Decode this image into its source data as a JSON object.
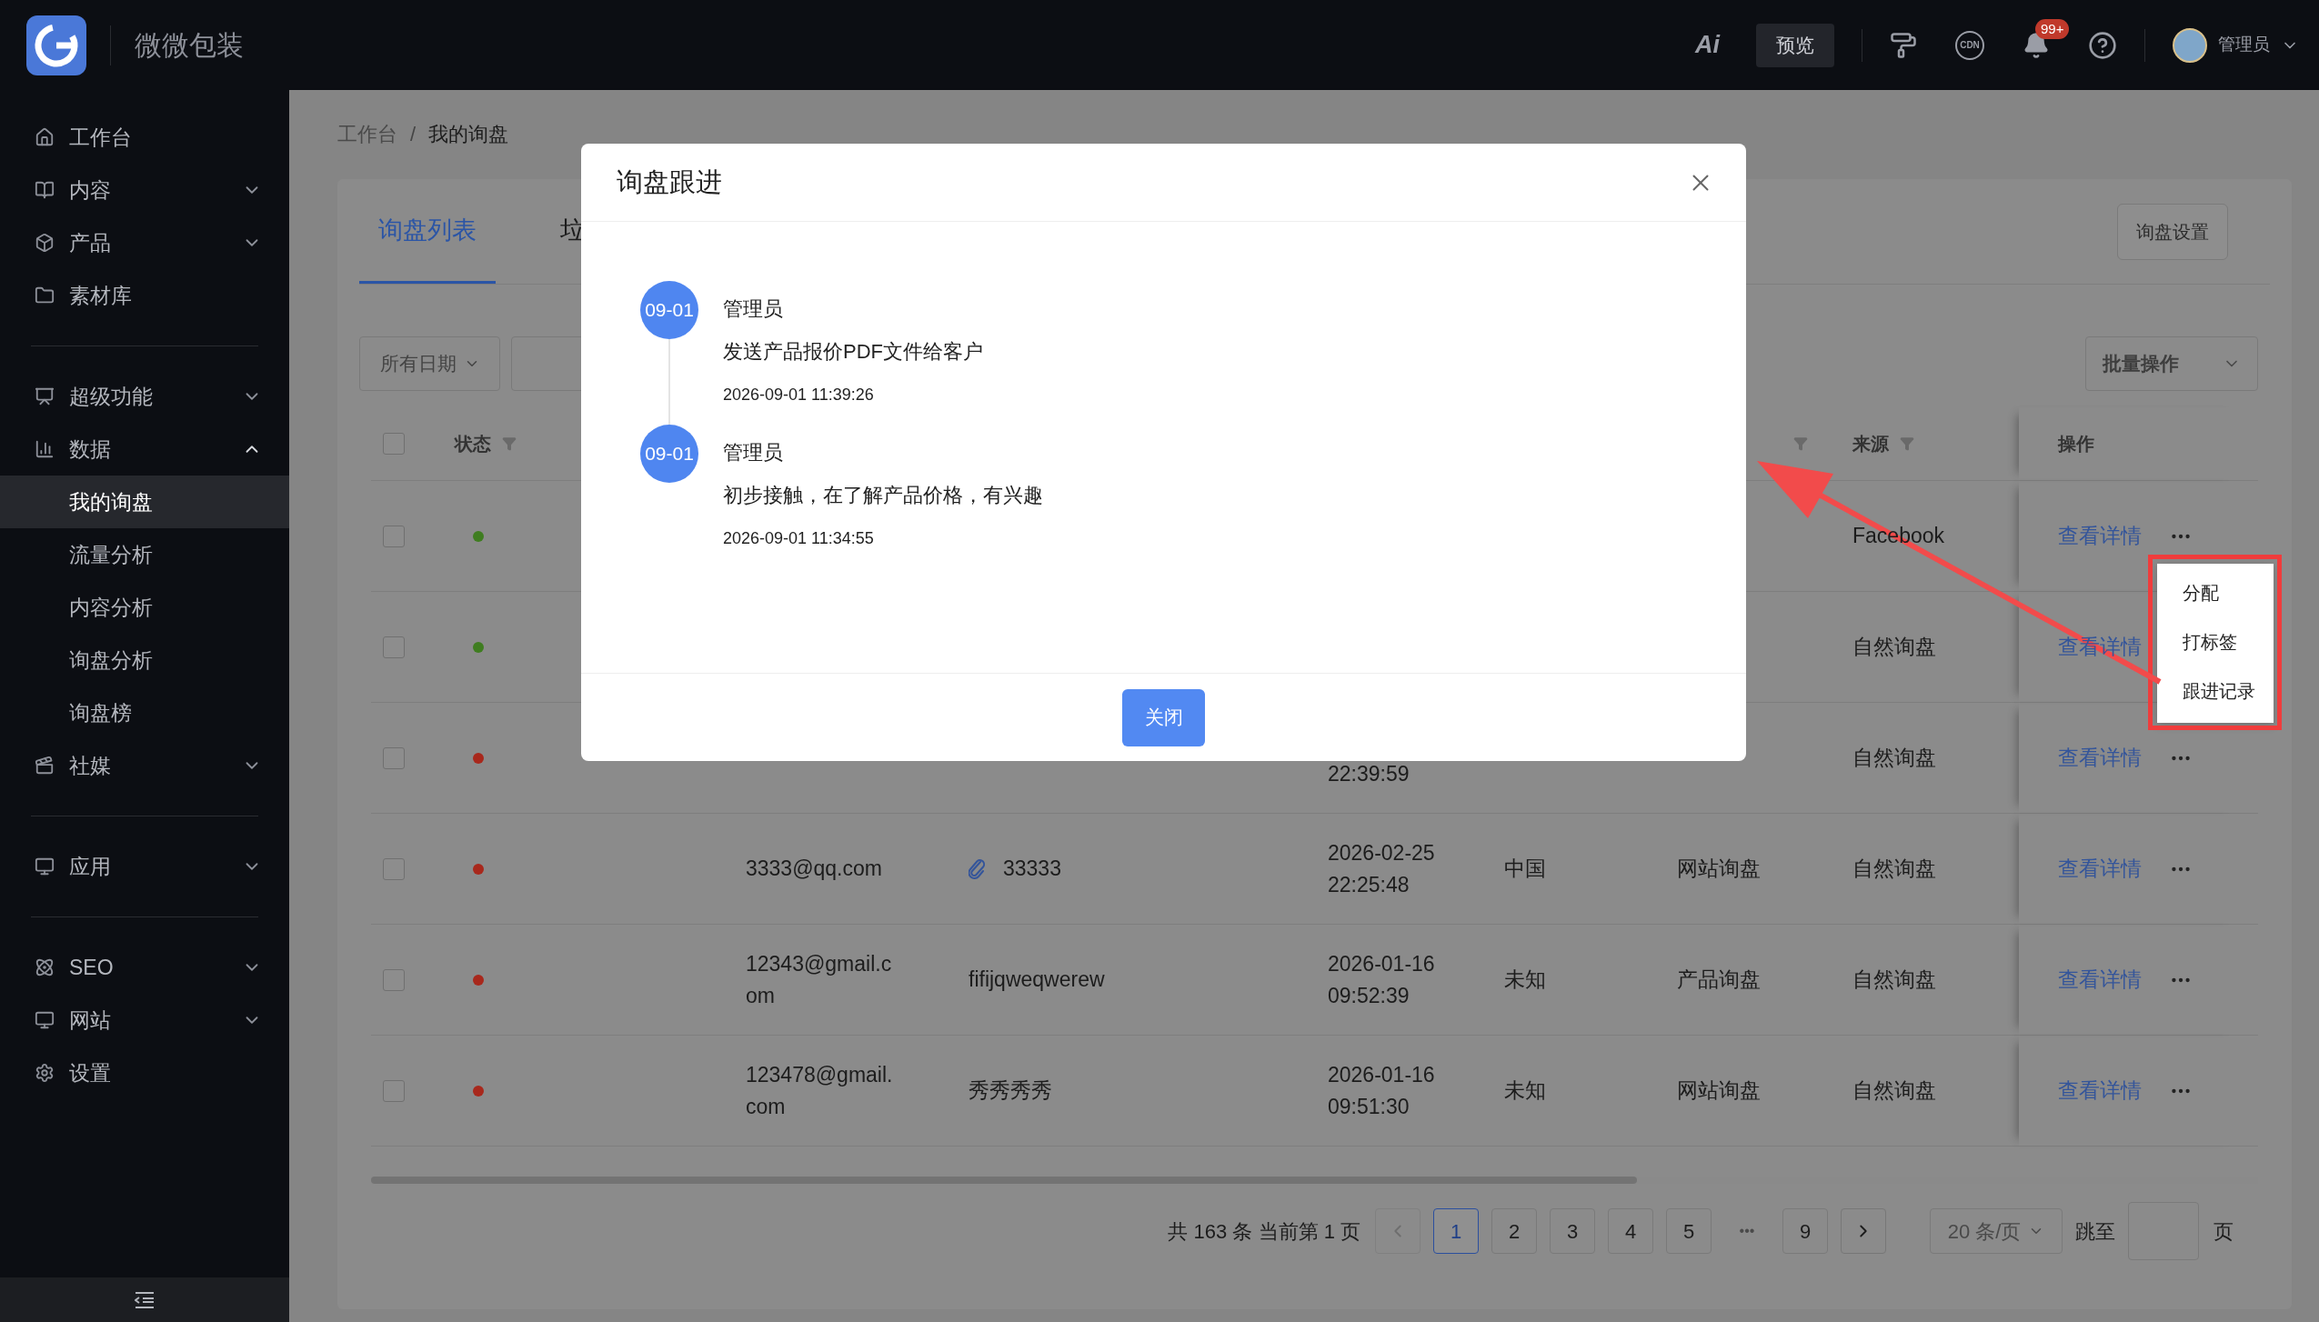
{
  "header": {
    "logo_text": "微微包装",
    "ai_label": "Ai",
    "preview_button": "预览",
    "cdn_label": "CDN",
    "notification_badge": "99+",
    "user_name": "管理员"
  },
  "sidebar": {
    "sections": [
      {
        "items": [
          {
            "label": "工作台",
            "kind": "link",
            "selected": false
          },
          {
            "label": "内容",
            "kind": "group",
            "expanded": false,
            "selected": false
          },
          {
            "label": "产品",
            "kind": "group",
            "expanded": false,
            "selected": false
          },
          {
            "label": "素材库",
            "kind": "link",
            "selected": false
          }
        ]
      },
      {
        "items": [
          {
            "label": "超级功能",
            "kind": "group",
            "expanded": false,
            "selected": false
          },
          {
            "label": "数据",
            "kind": "group",
            "expanded": true,
            "selected": false,
            "children": [
              {
                "label": "我的询盘",
                "selected": true
              },
              {
                "label": "流量分析",
                "selected": false
              },
              {
                "label": "内容分析",
                "selected": false
              },
              {
                "label": "询盘分析",
                "selected": false
              },
              {
                "label": "询盘榜",
                "selected": false
              }
            ]
          },
          {
            "label": "社媒",
            "kind": "group",
            "expanded": false,
            "selected": false
          }
        ]
      },
      {
        "items": [
          {
            "label": "应用",
            "kind": "group",
            "expanded": false,
            "selected": false
          }
        ]
      },
      {
        "items": [
          {
            "label": "SEO",
            "kind": "group",
            "expanded": false,
            "selected": false
          },
          {
            "label": "网站",
            "kind": "group",
            "expanded": false,
            "selected": false
          },
          {
            "label": "设置",
            "kind": "link",
            "selected": false
          }
        ]
      }
    ]
  },
  "breadcrumb": {
    "items": [
      "工作台",
      "我的询盘"
    ],
    "separator": "/"
  },
  "tabs": [
    {
      "label": "询盘列表",
      "selected": true
    },
    {
      "label": "垃",
      "selected": false
    }
  ],
  "settings_button": "询盘设置",
  "filters": {
    "date_select": "所有日期",
    "batch_select": "批量操作"
  },
  "table": {
    "header": {
      "select_all": {
        "checked": false
      },
      "status": {
        "label": "状态",
        "filter": true
      },
      "type": {
        "filter": true
      },
      "source": {
        "label": "来源",
        "filter": true
      },
      "actions": {
        "label": "操作"
      }
    },
    "rows": [
      {
        "checked": false,
        "color": "#3f7d20",
        "source": "Facebook",
        "action": "查看详情"
      },
      {
        "checked": false,
        "color": "#3f7d20",
        "source": "自然询盘",
        "action": "查看详情"
      },
      {
        "checked": false,
        "color": "#a8281c",
        "time_clock": "22:39:59",
        "source": "自然询盘",
        "action": "查看详情"
      },
      {
        "checked": false,
        "color": "#a8281c",
        "email": "3333@qq.com",
        "attachment": true,
        "subject": "33333",
        "time_date": "2026-02-25",
        "time_clock": "22:25:48",
        "country": "中国",
        "type": "网站询盘",
        "source": "自然询盘",
        "action": "查看详情"
      },
      {
        "checked": false,
        "color": "#a8281c",
        "email": "12343@gmail.com",
        "attachment": false,
        "subject": "fifijqweqwerew",
        "time_date": "2026-01-16",
        "time_clock": "09:52:39",
        "country": "未知",
        "type": "产品询盘",
        "source": "自然询盘",
        "action": "查看详情"
      },
      {
        "checked": false,
        "color": "#a8281c",
        "email": "123478@gmail.com",
        "attachment": false,
        "subject": "秀秀秀秀",
        "time_date": "2026-01-16",
        "time_clock": "09:51:30",
        "country": "未知",
        "type": "网站询盘",
        "source": "自然询盘",
        "action": "查看详情"
      }
    ]
  },
  "pagination": {
    "summary": "共 163 条 当前第 1 页",
    "prev": {
      "disabled": true
    },
    "next": {
      "disabled": false
    },
    "pages": [
      {
        "label": "1",
        "kind": "page",
        "selected": true
      },
      {
        "label": "2",
        "kind": "page",
        "selected": false
      },
      {
        "label": "3",
        "kind": "page",
        "selected": false
      },
      {
        "label": "4",
        "kind": "page",
        "selected": false
      },
      {
        "label": "5",
        "kind": "page",
        "selected": false
      },
      {
        "label": "•••",
        "kind": "ellipsis",
        "selected": false
      },
      {
        "label": "9",
        "kind": "page",
        "selected": false
      }
    ],
    "page_size": "20 条/页",
    "jump_label": "跳至",
    "page_suffix": "页"
  },
  "modal": {
    "title": "询盘跟进",
    "entries": [
      {
        "date_badge": "09-01",
        "author": "管理员",
        "note": "发送产品报价PDF文件给客户",
        "time": "2026-09-01 11:39:26"
      },
      {
        "date_badge": "09-01",
        "author": "管理员",
        "note": "初步接触，在了解产品价格，有兴趣",
        "time": "2026-09-01 11:34:55"
      }
    ],
    "close_button": "关闭"
  },
  "row_menu": {
    "open": true,
    "items": [
      "分配",
      "打标签",
      "跟进记录"
    ]
  }
}
